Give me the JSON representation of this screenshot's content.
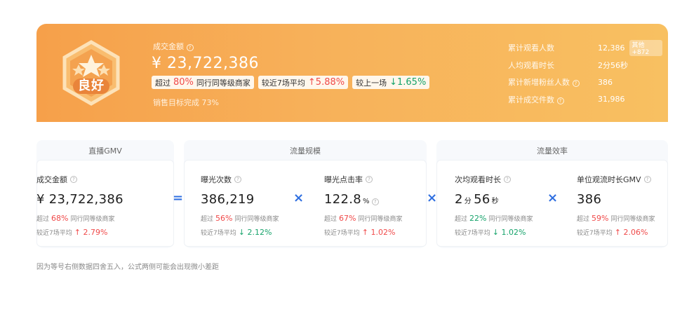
{
  "summary": {
    "badge_text": "良好",
    "gmv_title": "成交金额",
    "gmv_value": "¥ 23,722,386",
    "chips": [
      {
        "pre": "超过",
        "value": "80%",
        "post": "同行同等级商家",
        "dir": "red"
      },
      {
        "pre": "较近7场平均",
        "value": "↑5.88%",
        "post": "",
        "dir": "red"
      },
      {
        "pre": "较上一场",
        "value": "↓1.65%",
        "post": "",
        "dir": "green"
      }
    ],
    "target_text": "销售目标完成 73%",
    "kpis": [
      {
        "label": "累计观看人数",
        "value": "12,386",
        "tag": "其他+872"
      },
      {
        "label": "人均观看时长",
        "value": "2分56秒",
        "tag": ""
      },
      {
        "label": "累计新增粉丝人数",
        "value": "386",
        "tag": ""
      },
      {
        "label": "累计成交件数",
        "value": "31,986",
        "tag": ""
      }
    ]
  },
  "sections": {
    "gmv": "直播GMV",
    "traffic": "流量规模",
    "efficiency": "流量效率"
  },
  "metrics": {
    "m1": {
      "label": "成交金额",
      "value": "¥ 23,722,386",
      "pct": "68%",
      "beat": "同行同等级商家",
      "cmp_label": "较近7场平均",
      "cmp": "↑ 2.79%"
    },
    "m2": {
      "label": "曝光次数",
      "value": "386,219",
      "pct": "56%",
      "beat": "同行同等级商家",
      "cmp_label": "较近7场平均",
      "cmp": "↓ 2.12%"
    },
    "m3": {
      "label": "曝光点击率",
      "value": "122.8",
      "unit": "%",
      "pct": "67%",
      "beat": "同行同等级商家",
      "cmp_label": "较近7场平均",
      "cmp": "↑ 1.02%"
    },
    "m4": {
      "label": "次均观看时长",
      "value_a": "2",
      "unit_a": "分",
      "value_b": "56",
      "unit_b": "秒",
      "pct": "22%",
      "beat": "同行同等级商家",
      "cmp_label": "较近7场平均",
      "cmp": "↓ 1.02%"
    },
    "m5": {
      "label": "单位观流时长GMV",
      "value": "386",
      "pct": "59%",
      "beat": "同行同等级商家",
      "cmp_label": "较近7场平均",
      "cmp": "↑ 2.06%"
    }
  },
  "operators": {
    "eq": "=",
    "times": "×"
  },
  "common": {
    "beat_pre": "超过"
  },
  "footnote": "因为等号右侧数据四舍五入，公式两侧可能会出现微小差距",
  "colors": {
    "up": "#f04a4a",
    "down": "#16a36b",
    "operator": "#2f6fe0",
    "banner": "#f6a04a"
  }
}
